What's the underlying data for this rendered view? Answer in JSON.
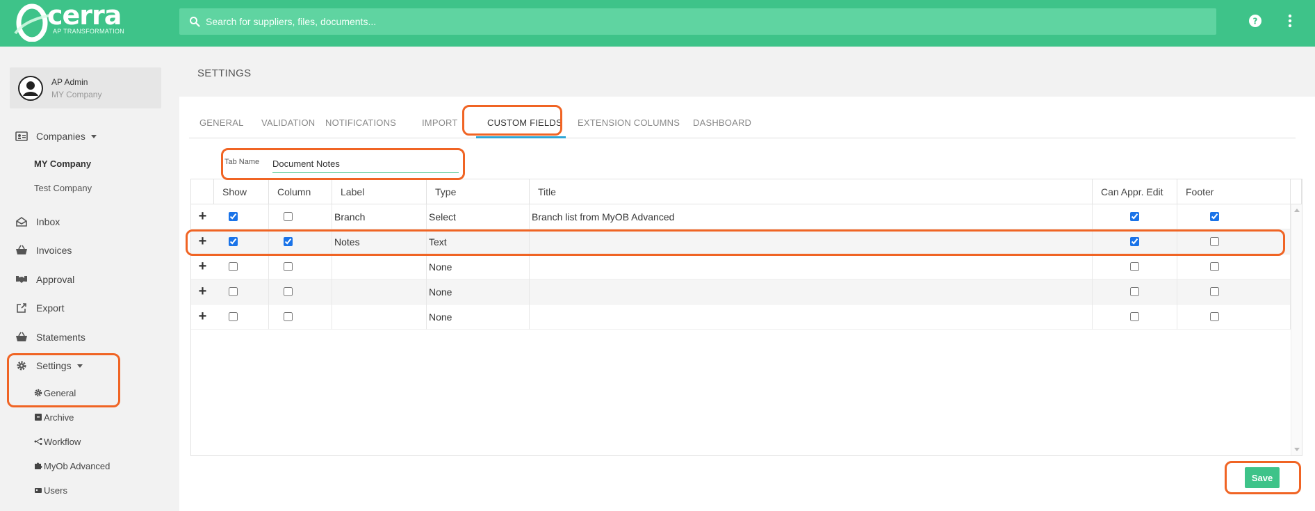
{
  "brand": {
    "name": "cerra",
    "tagline": "AP TRANSFORMATION"
  },
  "header": {
    "search_placeholder": "Search for suppliers, files, documents...",
    "icons": [
      "search-icon",
      "help-icon",
      "more-vert-icon"
    ]
  },
  "user": {
    "name": "AP Admin",
    "company": "MY Company"
  },
  "sidebar": {
    "companies": {
      "label": "Companies",
      "items": [
        "MY Company",
        "Test Company"
      ]
    },
    "items": [
      {
        "label": "Inbox",
        "icon": "inbox-icon"
      },
      {
        "label": "Invoices",
        "icon": "basket-icon"
      },
      {
        "label": "Approval",
        "icon": "handshake-icon"
      },
      {
        "label": "Export",
        "icon": "export-icon"
      },
      {
        "label": "Statements",
        "icon": "basket-icon"
      }
    ],
    "settings": {
      "label": "Settings",
      "items": [
        {
          "label": "General",
          "icon": "gear-icon"
        },
        {
          "label": "Archive",
          "icon": "archive-icon"
        },
        {
          "label": "Workflow",
          "icon": "workflow-icon"
        },
        {
          "label": "MyOb Advanced",
          "icon": "puzzle-icon"
        },
        {
          "label": "Users",
          "icon": "users-icon"
        }
      ]
    }
  },
  "page": {
    "title": "SETTINGS"
  },
  "tabs": [
    "GENERAL",
    "VALIDATION",
    "NOTIFICATIONS",
    "IMPORT",
    "CUSTOM FIELDS",
    "EXTENSION COLUMNS",
    "DASHBOARD"
  ],
  "active_tab": "CUSTOM FIELDS",
  "tab_name": {
    "label": "Tab Name",
    "value": "Document Notes"
  },
  "grid": {
    "columns": [
      "Show",
      "Column",
      "Label",
      "Type",
      "Title",
      "Can Appr. Edit",
      "Footer"
    ],
    "rows": [
      {
        "show": true,
        "column": false,
        "label": "Branch",
        "type": "Select",
        "title": "Branch list from MyOB Advanced",
        "can_appr_edit": true,
        "footer": true
      },
      {
        "show": true,
        "column": true,
        "label": "Notes",
        "type": "Text",
        "title": "",
        "can_appr_edit": true,
        "footer": false
      },
      {
        "show": false,
        "column": false,
        "label": "",
        "type": "None",
        "title": "",
        "can_appr_edit": false,
        "footer": false
      },
      {
        "show": false,
        "column": false,
        "label": "",
        "type": "None",
        "title": "",
        "can_appr_edit": false,
        "footer": false
      },
      {
        "show": false,
        "column": false,
        "label": "",
        "type": "None",
        "title": "",
        "can_appr_edit": false,
        "footer": false
      }
    ]
  },
  "actions": {
    "save_label": "Save"
  },
  "colors": {
    "brand_green": "#3ec389",
    "search_bg": "#5fd4a1",
    "highlight": "#f06424",
    "tab_accent": "#2ea6d6"
  }
}
